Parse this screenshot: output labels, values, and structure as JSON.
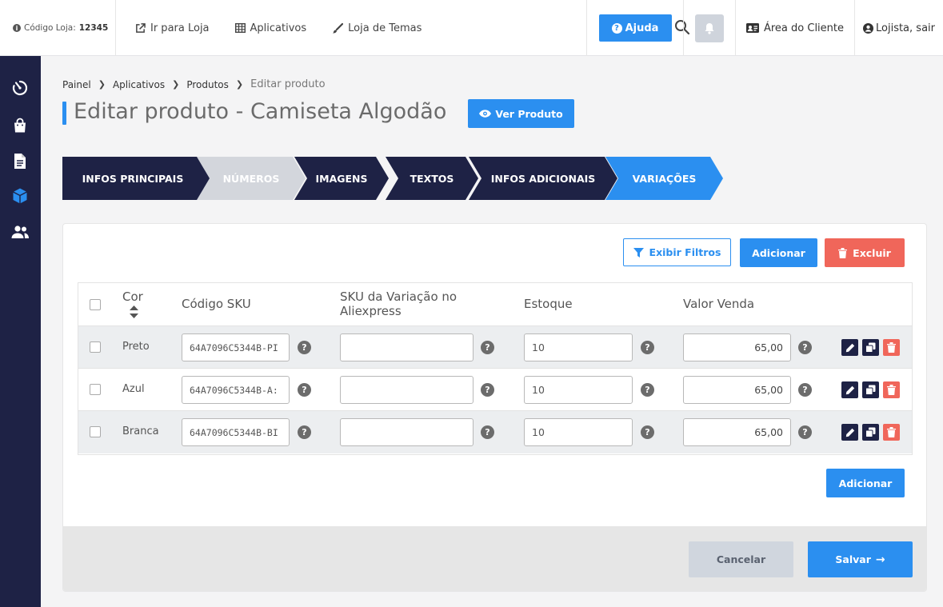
{
  "topbar": {
    "store_code_label": "Código Loja:",
    "store_code_value": "12345",
    "links": [
      "Ir para Loja",
      "Aplicativos",
      "Loja de Temas"
    ],
    "help_label": "Ajuda",
    "client_area_label": "Área do Cliente",
    "logout_label": "Lojista, sair"
  },
  "sidebar": {
    "icons": [
      "dashboard-icon",
      "shopping-bag-icon",
      "document-icon",
      "box-icon",
      "users-icon"
    ]
  },
  "breadcrumb": [
    "Painel",
    "Aplicativos",
    "Produtos",
    "Editar produto"
  ],
  "page": {
    "title": "Editar produto - Camiseta Algodão",
    "view_product_label": "Ver Produto"
  },
  "steps": [
    "INFOS PRINCIPAIS",
    "NÚMEROS",
    "IMAGENS",
    "TEXTOS",
    "INFOS ADICIONAIS",
    "VARIAÇÕES"
  ],
  "toolbar": {
    "filters_label": "Exibir Filtros",
    "add_label": "Adicionar",
    "delete_label": "Excluir"
  },
  "table": {
    "headers": {
      "color": "Cor",
      "sku": "Código SKU",
      "aliexpress_sku": "SKU da Variação no Aliexpress",
      "stock": "Estoque",
      "price": "Valor Venda"
    },
    "rows": [
      {
        "color": "Preto",
        "sku": "64A7096C5344B-PI",
        "aliexpress_sku": "",
        "stock": "10",
        "price": "65,00"
      },
      {
        "color": "Azul",
        "sku": "64A7096C5344B-A:",
        "aliexpress_sku": "",
        "stock": "10",
        "price": "65,00"
      },
      {
        "color": "Branca",
        "sku": "64A7096C5344B-BI",
        "aliexpress_sku": "",
        "stock": "10",
        "price": "65,00"
      }
    ],
    "help_mark": "?"
  },
  "bottom": {
    "add_label": "Adicionar",
    "cancel_label": "Cancelar",
    "save_label": "Salvar",
    "save_arrow": "→"
  },
  "colors": {
    "primary": "#2b8ff0",
    "navy": "#1e2245",
    "danger": "#f0665a",
    "step_inactive": "#d3d6dc"
  }
}
